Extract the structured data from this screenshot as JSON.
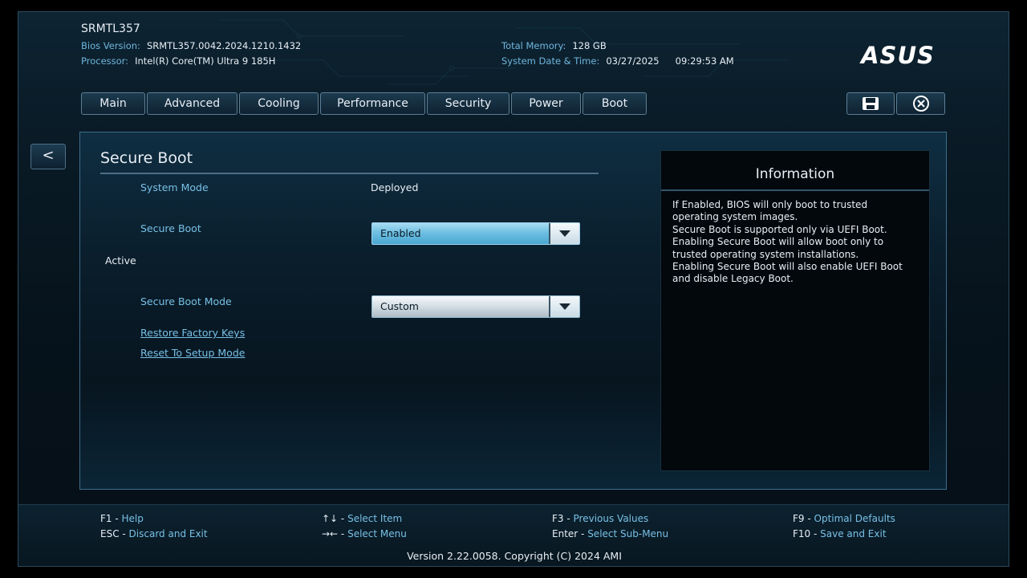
{
  "header": {
    "system_name": "SRMTL357",
    "bios_version_label": "Bios Version:",
    "bios_version": "SRMTL357.0042.2024.1210.1432",
    "processor_label": "Processor:",
    "processor": "Intel(R) Core(TM) Ultra 9 185H",
    "total_memory_label": "Total Memory:",
    "total_memory": "128 GB",
    "datetime_label": "System Date & Time:",
    "date": "03/27/2025",
    "time": "09:29:53 AM",
    "logo_text": "ASUS"
  },
  "tabs": [
    {
      "label": "Main"
    },
    {
      "label": "Advanced"
    },
    {
      "label": "Cooling"
    },
    {
      "label": "Performance"
    },
    {
      "label": "Security"
    },
    {
      "label": "Power"
    },
    {
      "label": "Boot"
    }
  ],
  "toolbar": {
    "save_icon": "save-icon",
    "exit_icon": "close-circle-icon"
  },
  "back_label": "<",
  "page": {
    "title": "Secure Boot",
    "system_mode_label": "System Mode",
    "system_mode_value": "Deployed",
    "secure_boot_label": "Secure Boot",
    "secure_boot_value": "Enabled",
    "secure_boot_status": "Active",
    "secure_boot_mode_label": "Secure Boot Mode",
    "secure_boot_mode_value": "Custom",
    "restore_keys_link": "Restore Factory Keys",
    "reset_setup_link": "Reset To Setup Mode"
  },
  "info": {
    "title": "Information",
    "lines": [
      "If Enabled, BIOS will only boot to trusted",
      "operating system images.",
      "Secure Boot is supported only via UEFI Boot.",
      "Enabling Secure Boot will allow boot only to",
      "trusted operating system installations.",
      "Enabling Secure Boot will also enable UEFI Boot",
      "and disable Legacy Boot."
    ]
  },
  "footer": {
    "keys": [
      {
        "key": "F1",
        "desc": "Help"
      },
      {
        "key": "ESC",
        "desc": "Discard and Exit"
      },
      {
        "key": "↑↓",
        "desc": "Select Item"
      },
      {
        "key": "→←",
        "desc": "Select Menu"
      },
      {
        "key": "F3",
        "desc": "Previous Values"
      },
      {
        "key": "Enter",
        "desc": "Select Sub-Menu"
      },
      {
        "key": "F9",
        "desc": "Optimal Defaults"
      },
      {
        "key": "F10",
        "desc": "Save and Exit"
      }
    ],
    "version": "Version 2.22.0058. Copyright (C) 2024 AMI"
  },
  "colors": {
    "accent": "#78c0e6",
    "text": "#e8eef4",
    "dropdown_active": "#6ebfe2",
    "background": "#06121b"
  }
}
